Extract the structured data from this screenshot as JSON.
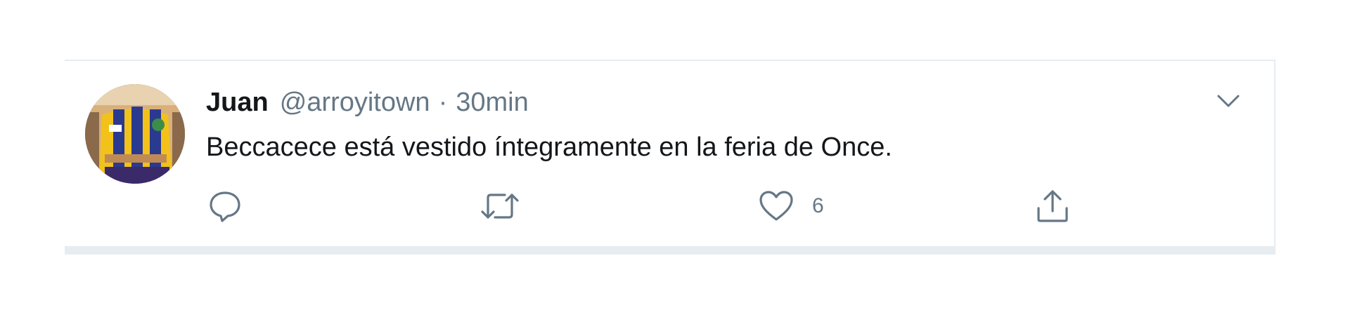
{
  "tweet": {
    "author_name": "Juan",
    "author_handle": "@arroyitown",
    "separator": "·",
    "timestamp": "30min",
    "text": "Beccacece está vestido íntegramente en la feria de Once."
  },
  "actions": {
    "reply_icon": "speech-bubble-icon",
    "retweet_icon": "retweet-arrows-icon",
    "like_icon": "heart-icon",
    "like_count": "6",
    "share_icon": "share-upload-icon",
    "menu_icon": "chevron-down-icon"
  },
  "colors": {
    "name": "#14171a",
    "secondary_text": "#657786",
    "border": "#e6ecf0"
  }
}
